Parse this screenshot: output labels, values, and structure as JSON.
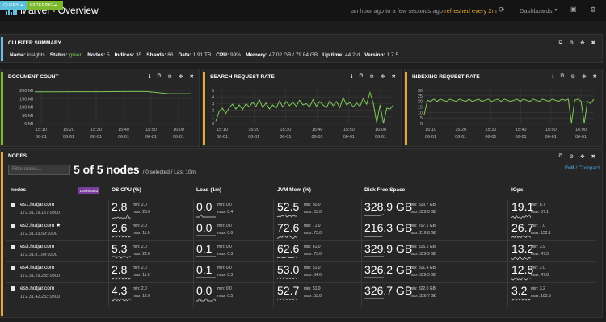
{
  "app": {
    "title": "Marvel - Overview",
    "logo_icon": "marvel-logo-icon"
  },
  "topbar": {
    "time_range": "an hour ago to a few seconds ago",
    "refresh": "refreshed every 2m",
    "dashboards_label": "Dashboards",
    "dashboards_icon": "chevron-down-icon",
    "refresh_icon": "refresh-icon",
    "save_icon": "save-icon",
    "settings_icon": "gear-icon"
  },
  "filters": {
    "query_label": "QUERY",
    "filtering_label": "FILTERING",
    "query_color": "#5bc0de",
    "filtering_color": "#7cb92c"
  },
  "cluster_summary": {
    "title": "CLUSTER SUMMARY",
    "items": [
      {
        "label": "Name:",
        "value": "insights"
      },
      {
        "label": "Status:",
        "value": "green"
      },
      {
        "label": "Nodes:",
        "value": "5"
      },
      {
        "label": "Indices:",
        "value": "35"
      },
      {
        "label": "Shards:",
        "value": "86"
      },
      {
        "label": "Data:",
        "value": "1.91 TB"
      },
      {
        "label": "CPU:",
        "value": "99%"
      },
      {
        "label": "Memory:",
        "value": "47.02 GB / 79.84 GB"
      },
      {
        "label": "Up time:",
        "value": "44.2 d"
      },
      {
        "label": "Version:",
        "value": "1.7.5"
      }
    ]
  },
  "chart_data": [
    {
      "type": "line",
      "title": "DOCUMENT COUNT",
      "y_ticks": [
        "200 MI",
        "150 MI",
        "100 MI",
        "50 MI",
        "0 MI"
      ],
      "ylim": [
        0,
        200
      ],
      "x_ticks": [
        "15:10",
        "15:20",
        "15:30",
        "15:40",
        "15:50",
        "16:00"
      ],
      "x_date": "06-01",
      "series": [
        {
          "x": [
            "15:10",
            "15:20",
            "15:30",
            "15:40",
            "15:50",
            "16:00",
            "16:03",
            "16:08"
          ],
          "values": [
            191,
            191,
            192,
            192,
            193,
            193,
            180,
            180
          ]
        }
      ]
    },
    {
      "type": "line",
      "title": "SEARCH REQUEST RATE",
      "y_ticks": [
        "5",
        "4",
        "3",
        "2",
        "1",
        "0"
      ],
      "ylim": [
        0,
        5
      ],
      "x_ticks": [
        "15:10",
        "15:20",
        "15:30",
        "15:40",
        "15:50",
        "16:00"
      ],
      "x_date": "06-01",
      "series": [
        {
          "values": [
            0.3,
            1.8,
            2.3,
            1.5,
            2.4,
            2.9,
            2.2,
            2.8,
            2.1,
            3.0,
            2.5,
            3.2,
            2.6,
            3.6,
            2.4,
            3.1,
            2.2,
            2.8,
            2.3,
            3.4,
            2.5,
            3.3,
            2.7,
            3.2,
            2.6,
            3.5,
            2.8,
            3.0,
            2.5,
            3.6,
            2.6,
            3.3,
            2.8,
            2.4,
            3.4,
            2.7,
            3.3,
            2.4,
            3.9,
            2.8,
            3.2,
            2.5,
            3.1,
            2.6,
            3.8,
            2.9,
            4.7,
            3.0,
            0.1,
            2.8,
            0,
            2.3,
            2.2,
            2.8
          ]
        }
      ]
    },
    {
      "type": "line",
      "title": "INDEXING REQUEST RATE",
      "y_ticks": [
        "30",
        "25",
        "20",
        "15",
        "10",
        "5",
        "0"
      ],
      "ylim": [
        0,
        30
      ],
      "x_ticks": [
        "15:10",
        "15:20",
        "15:30",
        "15:40",
        "15:50",
        "16:00"
      ],
      "x_date": "06-01",
      "series": [
        {
          "values": [
            8,
            21,
            20,
            22,
            20,
            22,
            21,
            20,
            22,
            21,
            20,
            22,
            21,
            20,
            22,
            20,
            21,
            22,
            20,
            21,
            22,
            20,
            21,
            22,
            20,
            22,
            21,
            20,
            21,
            22,
            20,
            22,
            21,
            20,
            22,
            21,
            20,
            22,
            21,
            20,
            22,
            21,
            20,
            22,
            21,
            22,
            0,
            21,
            22,
            20,
            0,
            20,
            18,
            22
          ]
        }
      ]
    }
  ],
  "nodes_panel": {
    "title": "NODES",
    "filter_placeholder": "Filter nodes...",
    "count": "5 of 5 nodes",
    "count_sub": "/ 0 selected / Last 10m",
    "full": "Full",
    "slash": "/",
    "compact": "Compact",
    "dashboard_badge": "Dashboard",
    "columns": [
      "nodes",
      "OS CPU (%)",
      "Load (1m)",
      "JVM Mem (%)",
      "Disk Free Space",
      "IOps"
    ],
    "rows": [
      {
        "name": "es1.hotjar.com",
        "ip": "172.31.19.157:9300",
        "master": false,
        "cpu": {
          "v": "2.8",
          "min": "min: 2.0",
          "max": "max: 26.0",
          "spark": [
            3,
            2,
            3,
            2,
            4,
            2,
            3,
            2,
            3,
            2,
            8,
            2,
            3
          ]
        },
        "load": {
          "v": "0.0",
          "min": "min: 0.0",
          "max": "max: 0.4",
          "spark": [
            1,
            1,
            1,
            2,
            1,
            1,
            1,
            1,
            1,
            1,
            1,
            1,
            1
          ]
        },
        "jvm": {
          "v": "52.5",
          "min": "min: 50.0",
          "max": "max: 53.0",
          "spark": [
            3,
            4,
            3,
            5,
            4,
            6,
            3,
            4,
            5,
            3,
            5,
            4,
            4
          ]
        },
        "disk": {
          "v": "328.9 GB",
          "min": "min: 323.7 GB",
          "max": "max: 329.0 GB",
          "spark": [
            4,
            4,
            4,
            4,
            4,
            4,
            4,
            4,
            4,
            4,
            4,
            5,
            5
          ]
        },
        "iops": {
          "v": "19.1",
          "min": "min: 8.7",
          "max": "max: 57.1",
          "spark": [
            3,
            5,
            2,
            6,
            3,
            4,
            2,
            5,
            3,
            6,
            4,
            8,
            3
          ]
        }
      },
      {
        "name": "es2.hotjar.com",
        "ip": "172.31.33.59:9300",
        "master": true,
        "cpu": {
          "v": "2.6",
          "min": "min: 2.0",
          "max": "max: 11.0",
          "spark": [
            3,
            2,
            3,
            2,
            3,
            2,
            3,
            2,
            3,
            2,
            3,
            2,
            3
          ]
        },
        "load": {
          "v": "0.0",
          "min": "min: 0.0",
          "max": "max: 0.6",
          "spark": [
            1,
            1,
            1,
            1,
            1,
            1,
            1,
            1,
            1,
            1,
            1,
            1,
            1
          ]
        },
        "jvm": {
          "v": "72.6",
          "min": "min: 71.0",
          "max": "max: 73.0",
          "spark": [
            2,
            3,
            4,
            3,
            5,
            4,
            3,
            5,
            4,
            3,
            2,
            4,
            3
          ]
        },
        "disk": {
          "v": "216.3 GB",
          "min": "min: 207.1 GB",
          "max": "max: 216.8 GB",
          "spark": [
            4,
            4,
            4,
            4,
            4,
            4,
            4,
            4,
            4,
            4,
            4,
            4,
            5
          ]
        },
        "iops": {
          "v": "26.7",
          "min": "min: 7.0",
          "max": "max: 152.1",
          "spark": [
            3,
            4,
            3,
            5,
            3,
            4,
            3,
            5,
            4,
            3,
            5,
            4,
            3
          ]
        }
      },
      {
        "name": "es3.hotjar.com",
        "ip": "172.31.8.104:9300",
        "master": false,
        "cpu": {
          "v": "5.3",
          "min": "min: 2.0",
          "max": "max: 22.0",
          "spark": [
            3,
            3,
            3,
            2,
            3,
            3,
            2,
            3,
            3,
            3,
            2,
            3,
            3
          ]
        },
        "load": {
          "v": "0.1",
          "min": "min: 0.0",
          "max": "max: 0.3",
          "spark": [
            1,
            1,
            1,
            1,
            1,
            1,
            1,
            1,
            1,
            1,
            1,
            1,
            1
          ]
        },
        "jvm": {
          "v": "62.6",
          "min": "min: 61.0",
          "max": "max: 73.0",
          "spark": [
            3,
            3,
            4,
            3,
            3,
            3,
            4,
            3,
            3,
            3,
            3,
            4,
            3
          ]
        },
        "disk": {
          "v": "329.9 GB",
          "min": "min: 325.1 GB",
          "max": "max: 329.9 GB",
          "spark": [
            4,
            4,
            4,
            4,
            4,
            4,
            4,
            4,
            4,
            4,
            4,
            4,
            4
          ]
        },
        "iops": {
          "v": "13.2",
          "min": "min: 3.9",
          "max": "max: 47.5",
          "spark": [
            3,
            2,
            4,
            3,
            2,
            5,
            3,
            2,
            4,
            3,
            2,
            4,
            3
          ]
        }
      },
      {
        "name": "es4.hotjar.com",
        "ip": "172.31.29.235:9300",
        "master": false,
        "cpu": {
          "v": "2.8",
          "min": "min: 2.0",
          "max": "max: 11.0",
          "spark": [
            3,
            2,
            3,
            2,
            3,
            2,
            3,
            2,
            3,
            2,
            3,
            2,
            3
          ]
        },
        "load": {
          "v": "0.1",
          "min": "min: 0.0",
          "max": "max: 0.3",
          "spark": [
            1,
            1,
            1,
            1,
            1,
            1,
            1,
            1,
            1,
            1,
            1,
            1,
            1
          ]
        },
        "jvm": {
          "v": "53.0",
          "min": "min: 51.0",
          "max": "max: 54.0",
          "spark": [
            3,
            4,
            3,
            4,
            3,
            4,
            3,
            4,
            3,
            4,
            3,
            4,
            3
          ]
        },
        "disk": {
          "v": "326.2 GB",
          "min": "min: 321.4 GB",
          "max": "max: 326.3 GB",
          "spark": [
            4,
            4,
            4,
            4,
            4,
            4,
            4,
            4,
            4,
            4,
            4,
            4,
            4
          ]
        },
        "iops": {
          "v": "12.5",
          "min": "min: 2.0",
          "max": "max: 47.8",
          "spark": [
            3,
            2,
            3,
            4,
            2,
            3,
            2,
            4,
            3,
            2,
            3,
            4,
            3
          ]
        }
      },
      {
        "name": "es5.hotjar.com",
        "ip": "172.31.42.233:9300",
        "master": false,
        "cpu": {
          "v": "4.3",
          "min": "min: 2.0",
          "max": "max: 12.0",
          "spark": [
            3,
            2,
            4,
            2,
            3,
            2,
            4,
            3,
            2,
            3,
            2,
            4,
            3
          ]
        },
        "load": {
          "v": "0.0",
          "min": "min: 0.0",
          "max": "max: 0.5",
          "spark": [
            1,
            1,
            2,
            1,
            1,
            1,
            2,
            1,
            1,
            1,
            1,
            2,
            1
          ]
        },
        "jvm": {
          "v": "52.7",
          "min": "min: 51.0",
          "max": "max: 53.0",
          "spark": [
            3,
            4,
            3,
            4,
            3,
            4,
            3,
            4,
            3,
            4,
            3,
            4,
            3
          ]
        },
        "disk": {
          "v": "326.7 GB",
          "min": "min: 322.0 GB",
          "max": "max: 326.7 GB",
          "spark": [
            4,
            4,
            4,
            4,
            4,
            4,
            4,
            4,
            4,
            4,
            4,
            4,
            4
          ]
        },
        "iops": {
          "v": "3.2",
          "min": "min: 3.2",
          "max": "max: 105.6",
          "spark": [
            3,
            2,
            3,
            2,
            3,
            2,
            3,
            2,
            3,
            2,
            3,
            2,
            3
          ]
        }
      }
    ]
  },
  "panel_icons": [
    "info-icon",
    "copy-icon",
    "gear-icon",
    "move-icon",
    "close-icon"
  ],
  "panel_accent_colors": {
    "cluster": "#6dc0e6",
    "doc": "#7cb92c",
    "search": "#e5a63a",
    "indexing": "#e5a63a",
    "nodes": "#e5a63a"
  },
  "line_color": "#7dc856"
}
